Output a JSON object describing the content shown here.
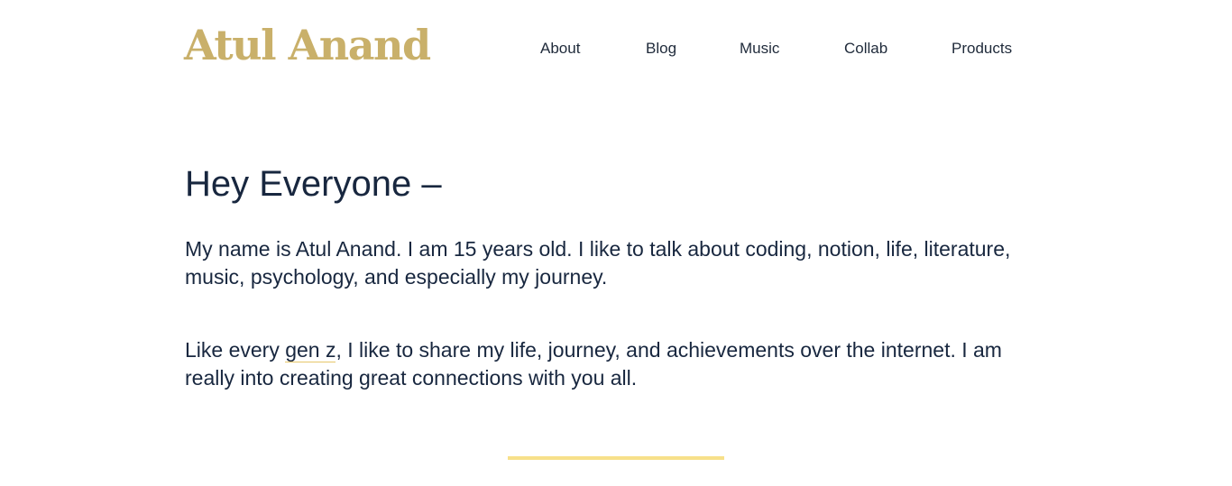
{
  "header": {
    "logo": "Atul Anand",
    "nav": [
      "About",
      "Blog",
      "Music",
      "Collab",
      "Products"
    ]
  },
  "main": {
    "heading": "Hey Everyone –",
    "para1": "My name is Atul Anand. I am 15 years old. I like to talk about coding, notion, life, literature, music, psychology, and especially my journey.",
    "para2_before": "Like every ",
    "para2_link": "gen z",
    "para2_after": ", I like to share my life, journey, and achievements over the internet. I am really into creating great connections with you all."
  },
  "colors": {
    "logo": "#c9b06a",
    "text": "#18273f",
    "link_underline": "#e6c76a",
    "divider": "#f7e08a",
    "background": "#ffffff"
  }
}
